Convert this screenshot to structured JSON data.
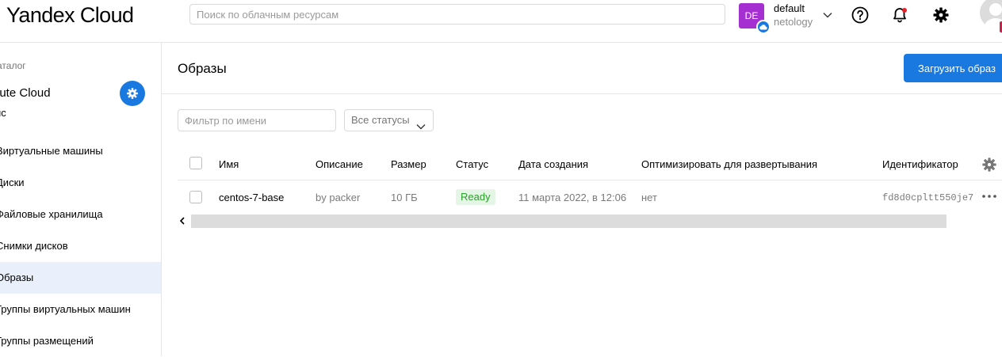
{
  "header": {
    "logo": "Yandex Cloud",
    "search_placeholder": "Поиск по облачным ресурсам",
    "account": {
      "initials": "DE",
      "name": "default",
      "sub": "netology"
    }
  },
  "sidebar": {
    "catalog_label": "аталог",
    "service_title": "pute Cloud",
    "service_sub": "ис",
    "items": [
      {
        "label": "Виртуальные машины"
      },
      {
        "label": "Диски"
      },
      {
        "label": "Файловые хранилища"
      },
      {
        "label": "Снимки дисков"
      },
      {
        "label": "Образы",
        "active": true
      },
      {
        "label": "Группы виртуальных машин"
      },
      {
        "label": "Группы размещений"
      }
    ]
  },
  "main": {
    "title": "Образы",
    "upload_button": "Загрузить образ",
    "filter_placeholder": "Фильтр по имени",
    "status_filter": "Все статусы",
    "columns": {
      "name": "Имя",
      "description": "Описание",
      "size": "Размер",
      "status": "Статус",
      "created": "Дата создания",
      "optimize": "Оптимизировать для развертывания",
      "id": "Идентификатор"
    },
    "rows": [
      {
        "name": "centos-7-base",
        "description": "by packer",
        "size": "10 ГБ",
        "status": "Ready",
        "created": "11 марта 2022, в 12:06",
        "optimize": "нет",
        "id": "fd8d0cpltt550je7"
      }
    ]
  },
  "colors": {
    "accent": "#1a79e0",
    "avatar": "#a62fd1",
    "ready_bg": "#e6f6e6",
    "ready_text": "#2aa02a",
    "active_item_bg": "#e9f0fb"
  }
}
